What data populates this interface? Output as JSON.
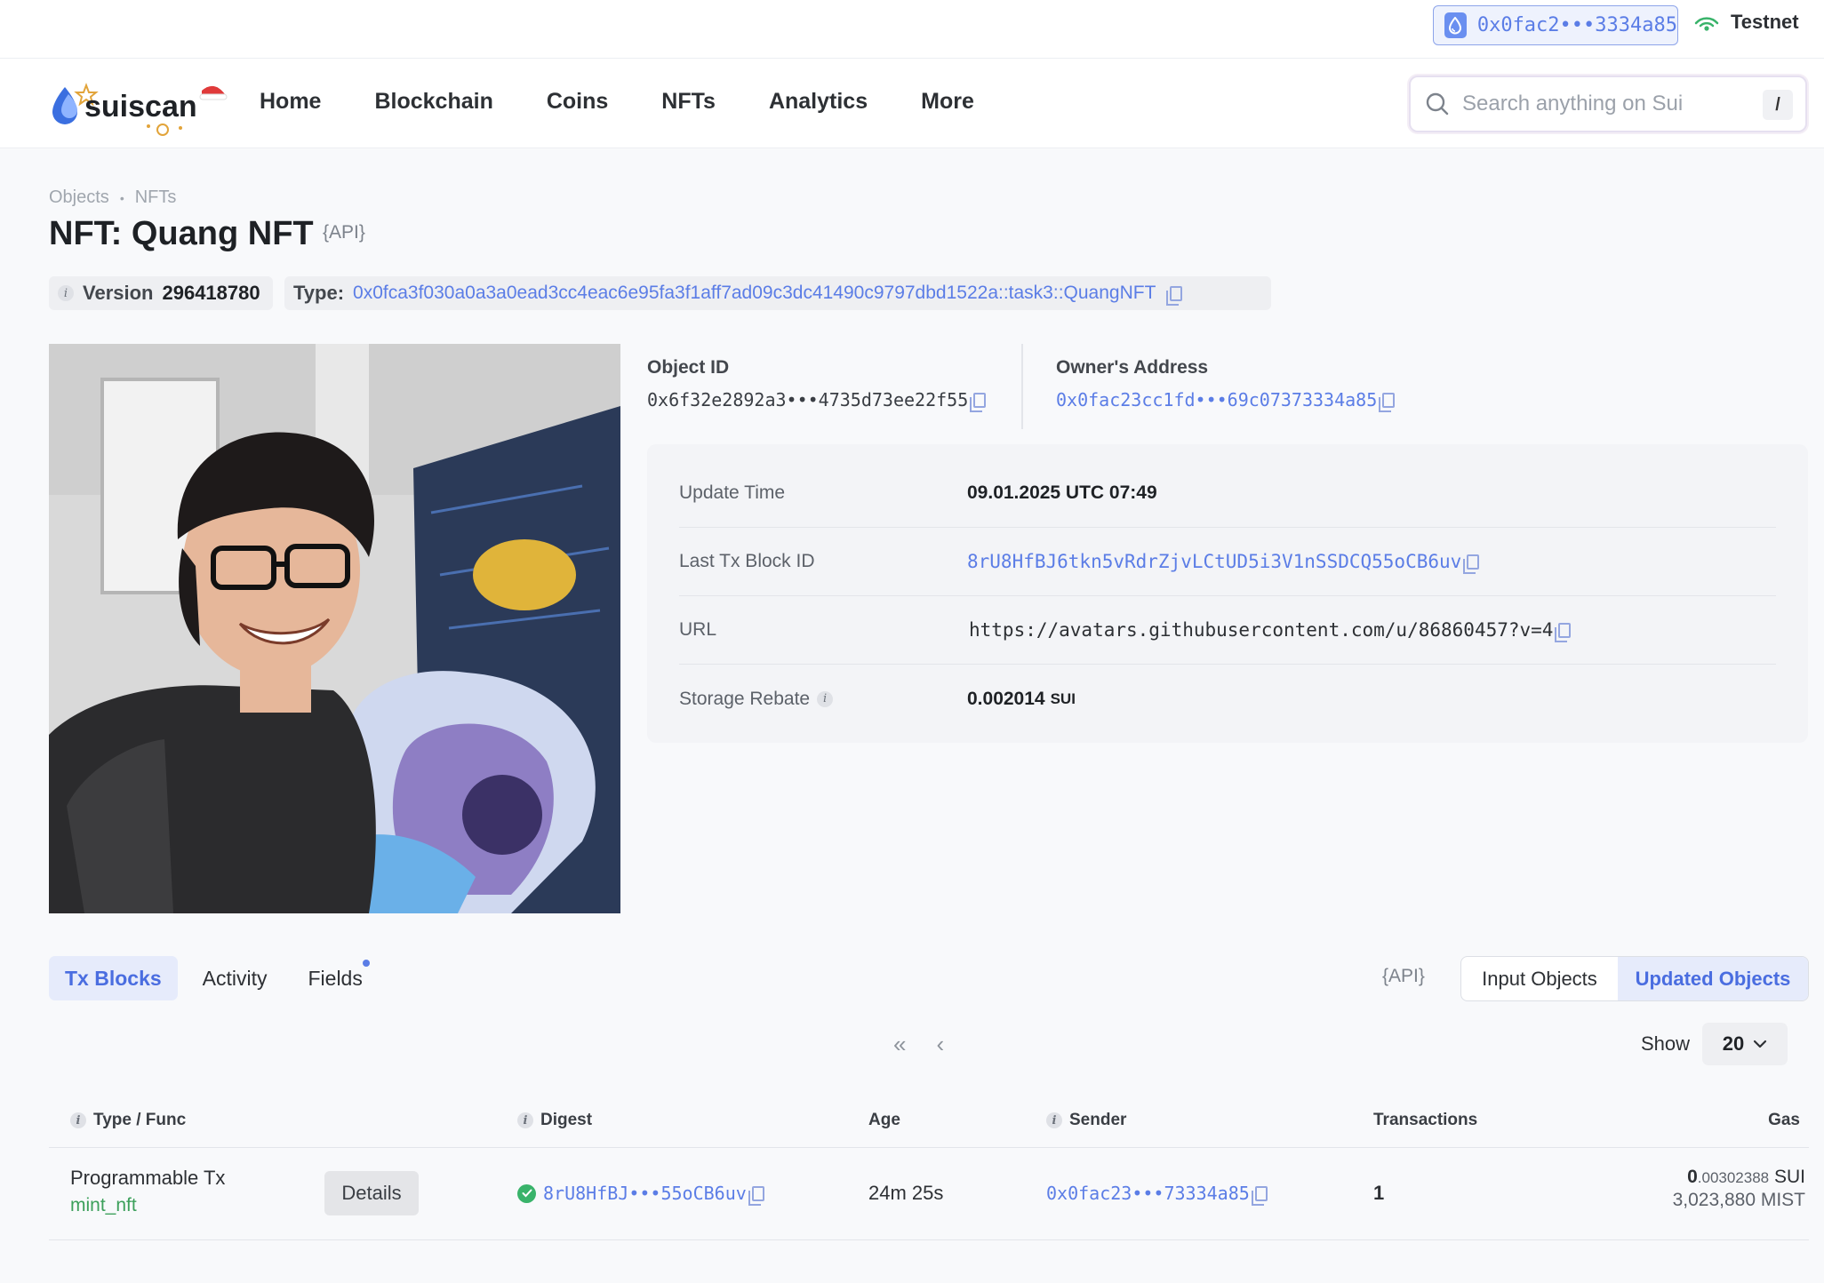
{
  "topbar": {
    "wallet_address": "0x0fac2•••3334a85",
    "network": "Testnet"
  },
  "header": {
    "logo_text": "suiscan",
    "nav": [
      "Home",
      "Blockchain",
      "Coins",
      "NFTs",
      "Analytics",
      "More"
    ],
    "search_placeholder": "Search anything on Sui",
    "search_shortcut": "/"
  },
  "breadcrumb": [
    "Objects",
    "NFTs"
  ],
  "breadcrumb_sep": "•",
  "page": {
    "title": "NFT: Quang NFT",
    "api_label": "API",
    "version_label": "Version",
    "version_value": "296418780",
    "type_label": "Type:",
    "type_value": "0x0fca3f030a0a3a0ead3cc4eac6e95fa3f1aff7ad09c3dc41490c9797dbd1522a::task3::QuangNFT"
  },
  "object": {
    "object_id_label": "Object ID",
    "object_id": "0x6f32e2892a3•••4735d73ee22f55",
    "owner_label": "Owner's Address",
    "owner": "0x0fac23cc1fd•••69c07373334a85"
  },
  "details": {
    "update_time_label": "Update Time",
    "update_time": "09.01.2025 UTC 07:49",
    "last_tx_label": "Last Tx Block ID",
    "last_tx": "8rU8HfBJ6tkn5vRdrZjvLCtUD5i3V1nSSDCQ55oCB6uv",
    "url_label": "URL",
    "url": "https://avatars.githubusercontent.com/u/86860457?v=4",
    "rebate_label": "Storage Rebate",
    "rebate_value": "0.002014",
    "rebate_unit": "SUI"
  },
  "tabs": [
    "Tx Blocks",
    "Activity",
    "Fields"
  ],
  "filters": {
    "api_label": "API",
    "input_objects": "Input Objects",
    "updated_objects": "Updated Objects",
    "show_label": "Show",
    "show_value": "20",
    "first_page": "«",
    "prev_page": "‹"
  },
  "table": {
    "headers": {
      "type": "Type / Func",
      "digest": "Digest",
      "age": "Age",
      "sender": "Sender",
      "transactions": "Transactions",
      "gas": "Gas"
    },
    "rows": [
      {
        "type": "Programmable Tx",
        "func": "mint_nft",
        "details": "Details",
        "digest": "8rU8HfBJ•••55oCB6uv",
        "age": "24m 25s",
        "sender": "0x0fac23•••73334a85",
        "transactions": "1",
        "gas_int": "0",
        "gas_frac": ".00302388",
        "gas_unit": "SUI",
        "gas_mist": "3,023,880 MIST"
      }
    ]
  },
  "colors": {
    "accent": "#5b7de6",
    "success": "#39b36a",
    "func_green": "#3ca05b"
  }
}
